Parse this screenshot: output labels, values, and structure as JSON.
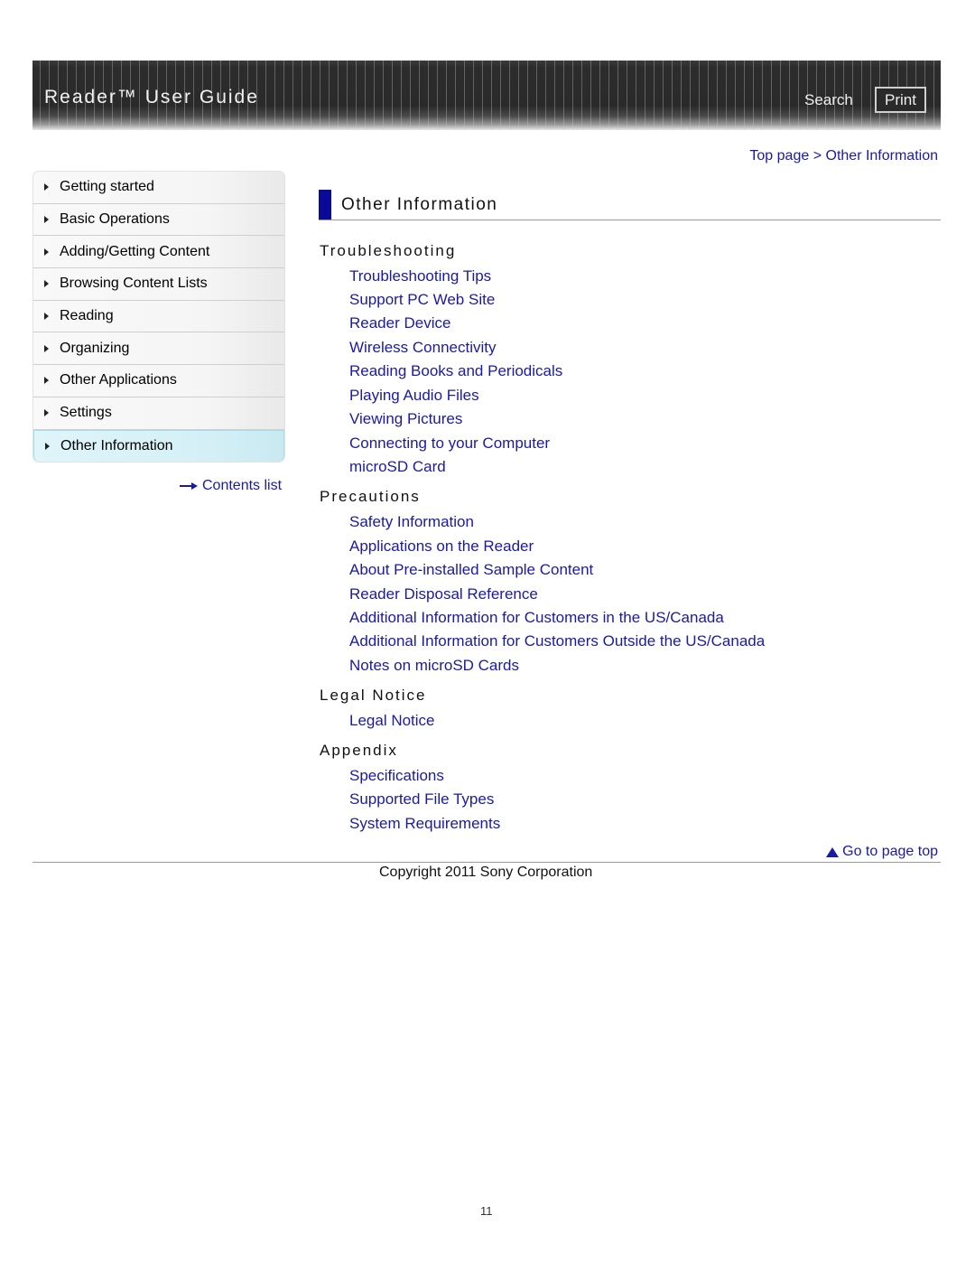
{
  "header": {
    "title": "Reader™ User Guide",
    "search_label": "Search",
    "print_label": "Print"
  },
  "breadcrumb": {
    "items": [
      "Top page",
      "Other Information"
    ],
    "separator": ">"
  },
  "sidebar": {
    "items": [
      {
        "label": "Getting started",
        "active": false
      },
      {
        "label": "Basic Operations",
        "active": false
      },
      {
        "label": "Adding/Getting Content",
        "active": false
      },
      {
        "label": "Browsing Content Lists",
        "active": false
      },
      {
        "label": "Reading",
        "active": false
      },
      {
        "label": "Organizing",
        "active": false
      },
      {
        "label": "Other Applications",
        "active": false
      },
      {
        "label": "Settings",
        "active": false
      },
      {
        "label": "Other Information",
        "active": true
      }
    ],
    "contents_link": "Contents list"
  },
  "main": {
    "title": "Other Information",
    "sections": [
      {
        "heading": "Troubleshooting",
        "links": [
          "Troubleshooting Tips",
          "Support PC Web Site",
          "Reader Device",
          "Wireless Connectivity",
          "Reading Books and Periodicals",
          "Playing Audio Files",
          "Viewing Pictures",
          "Connecting to your Computer",
          "microSD Card"
        ]
      },
      {
        "heading": "Precautions",
        "links": [
          "Safety Information",
          "Applications on the Reader",
          "About Pre-installed Sample Content",
          "Reader Disposal Reference",
          "Additional Information for Customers in the US/Canada",
          "Additional Information for Customers Outside the US/Canada",
          "Notes on microSD Cards"
        ]
      },
      {
        "heading": "Legal Notice",
        "links": [
          "Legal Notice"
        ]
      },
      {
        "heading": "Appendix",
        "links": [
          "Specifications",
          "Supported File Types",
          "System Requirements"
        ]
      }
    ]
  },
  "footer": {
    "go_top": "Go to page top",
    "copyright": "Copyright 2011 Sony Corporation",
    "page_number": "11"
  },
  "colors": {
    "link": "#1a1aa6",
    "title_bar": "#0a0a99",
    "header_bg": "#2b2b2b",
    "active_nav": "#d4f0f6"
  }
}
